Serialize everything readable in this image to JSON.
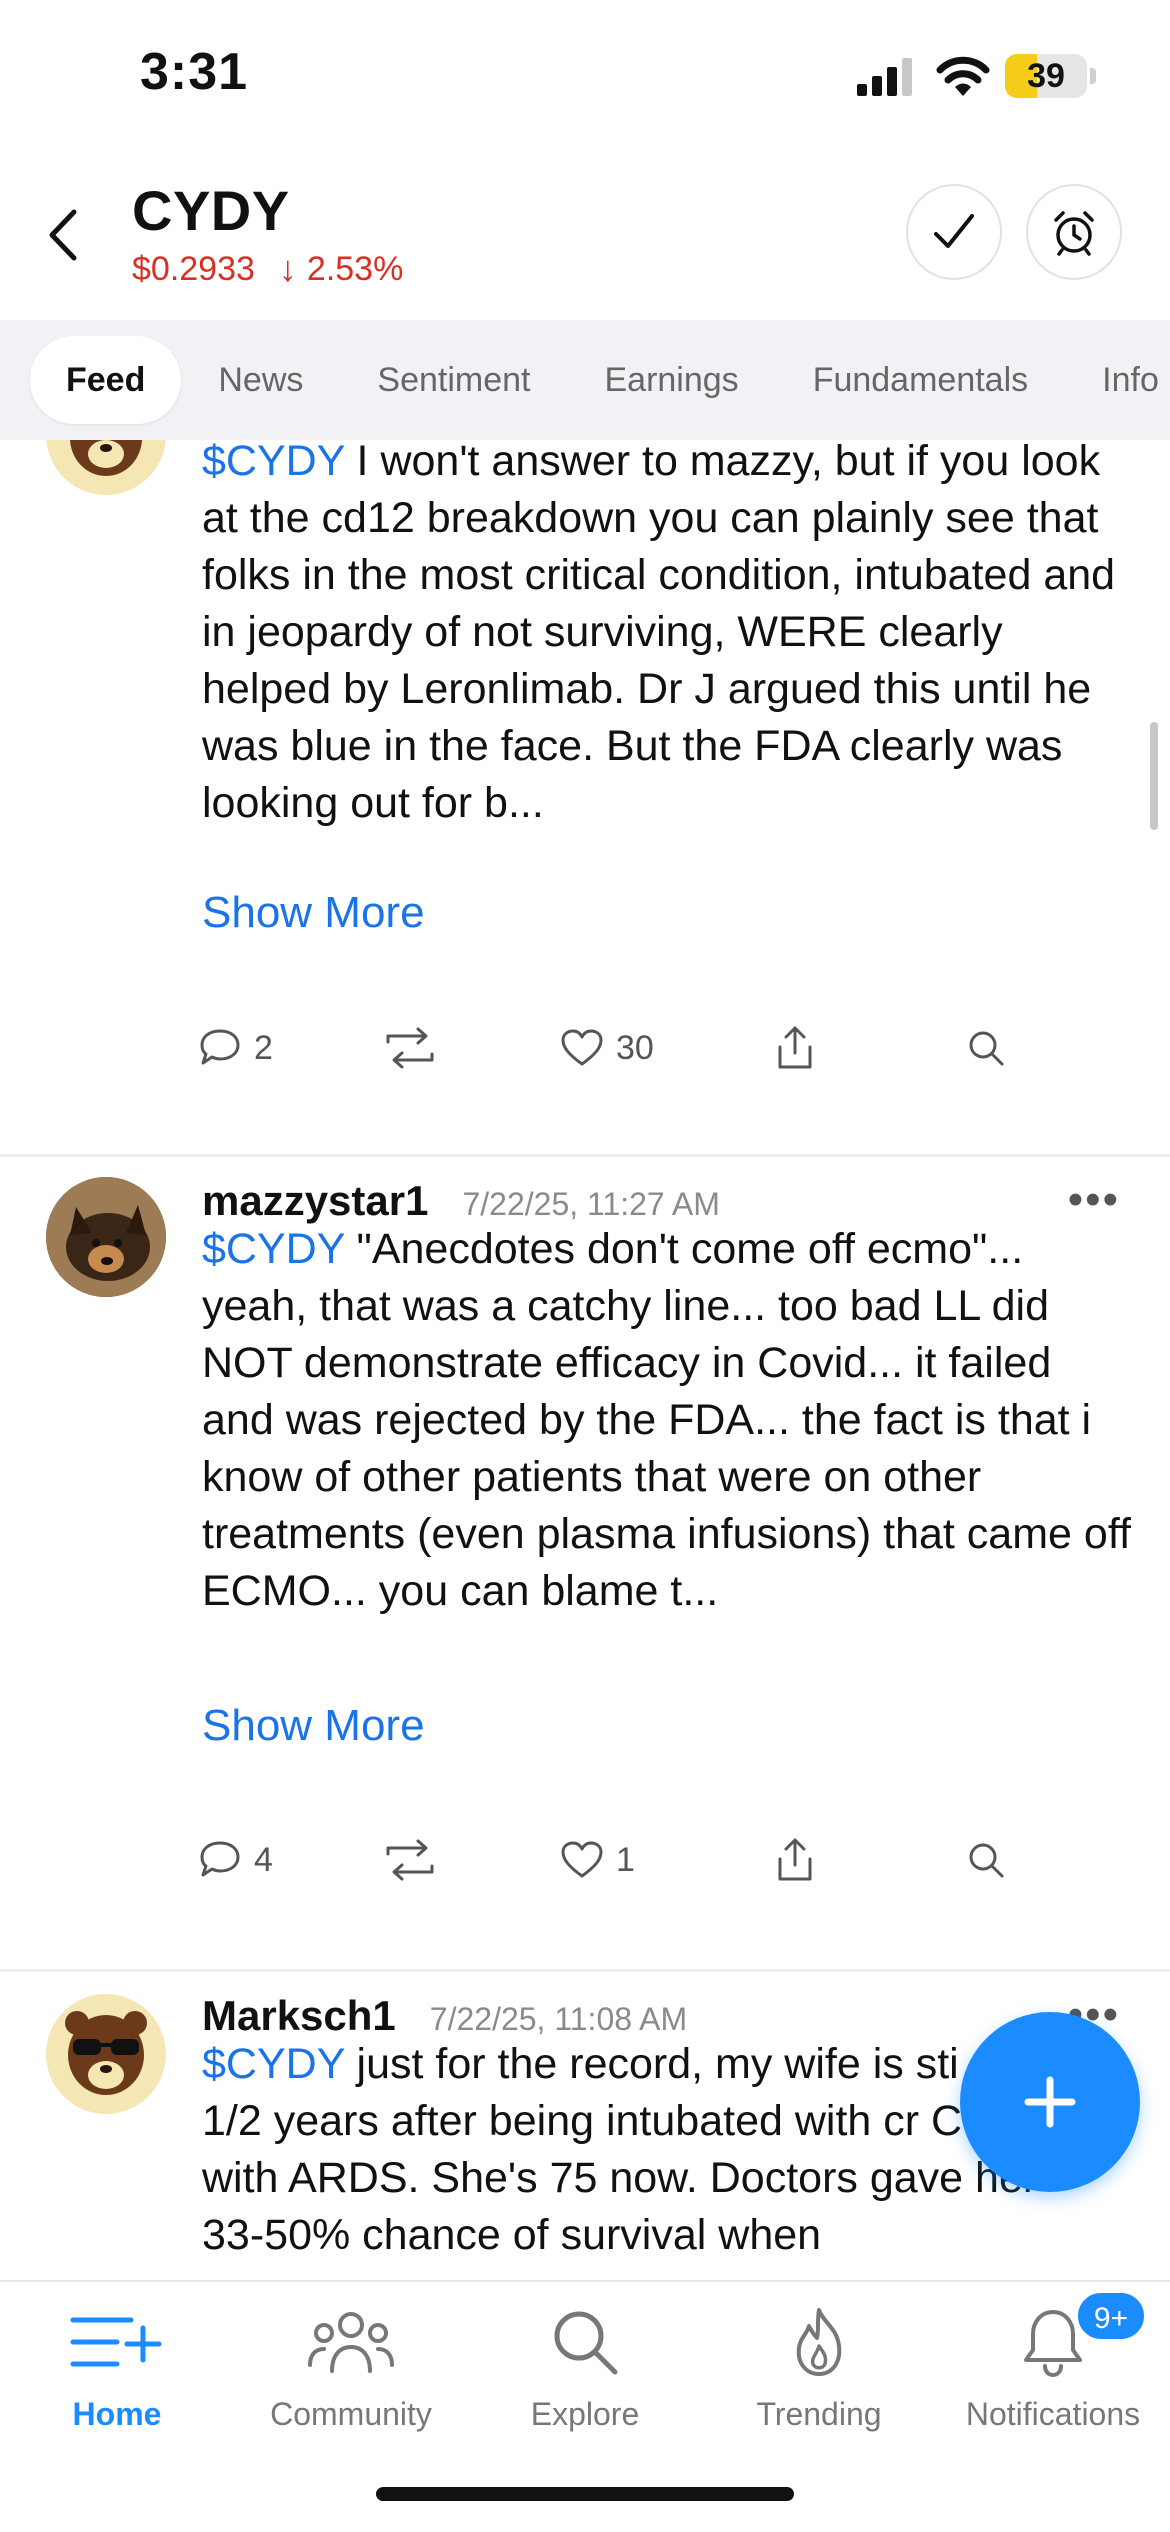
{
  "status_bar": {
    "time": "3:31",
    "battery_percent": "39",
    "battery_level": 0.39
  },
  "header": {
    "ticker": "CYDY",
    "price": "$0.2933",
    "change_arrow": "↓",
    "change": "2.53%",
    "down_color": "#d93025"
  },
  "tabs": [
    {
      "label": "Feed",
      "active": true
    },
    {
      "label": "News"
    },
    {
      "label": "Sentiment"
    },
    {
      "label": "Earnings"
    },
    {
      "label": "Fundamentals"
    },
    {
      "label": "Info"
    }
  ],
  "posts": [
    {
      "avatar": "bear-sunglasses-icon",
      "cashtag": "$CYDY",
      "text": " I won't answer to mazzy, but if you look at the cd12 breakdown you can plainly see that folks in the most critical condition, intubated and in jeopardy of not surviving, WERE clearly helped by Leronlimab. Dr J argued this until he was blue in the face. But the FDA clearly was looking out for b...",
      "show_more": "Show More",
      "comments": "2",
      "reposts": "",
      "likes": "30"
    },
    {
      "avatar": "dog-photo",
      "username": "mazzystar1",
      "timestamp": "7/22/25, 11:27 AM",
      "cashtag": "$CYDY",
      "text": " \"Anecdotes don't come off ecmo\"... yeah, that was a catchy line... too bad LL did NOT demonstrate efficacy in Covid... it failed and was rejected by the FDA... the fact is that i know of other patients that were on other treatments (even plasma infusions) that came off ECMO...  you can blame t...",
      "show_more": "Show More",
      "comments": "4",
      "reposts": "",
      "likes": "1"
    },
    {
      "avatar": "bear-sunglasses-icon",
      "username": "Marksch1",
      "timestamp": "7/22/25, 11:08 AM",
      "cashtag": "$CYDY",
      "text": " just for the record, my wife is sti 4 1/2 years after being intubated with cr Covid with ARDS. She's 75 now. Doctors gave her 33-50% chance of survival when"
    }
  ],
  "bottom_nav": [
    {
      "label": "Home",
      "icon": "home-feed-icon",
      "active": true
    },
    {
      "label": "Community",
      "icon": "people-icon"
    },
    {
      "label": "Explore",
      "icon": "search-icon"
    },
    {
      "label": "Trending",
      "icon": "flame-icon"
    },
    {
      "label": "Notifications",
      "icon": "bell-icon"
    }
  ],
  "notifications_badge": "9+",
  "accent_color": "#1a8cff",
  "link_color": "#1a73e8"
}
